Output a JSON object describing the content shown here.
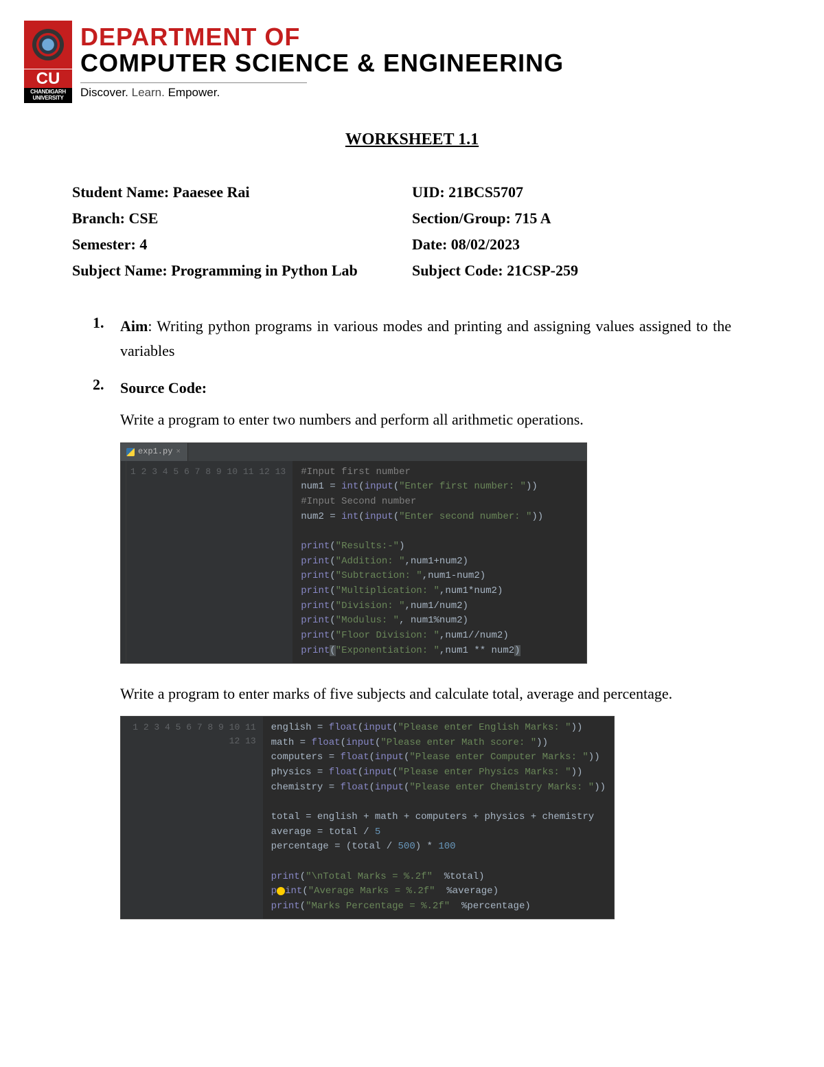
{
  "header": {
    "dept_line1": "DEPARTMENT OF",
    "dept_line2": "COMPUTER SCIENCE  & ENGINEERING",
    "cu": "CU",
    "univ": "CHANDIGARH UNIVERSITY",
    "tagline_1": "Discover. ",
    "tagline_2": "Learn. ",
    "tagline_3": "Empower."
  },
  "title": "WORKSHEET 1.1",
  "info": {
    "student_name": "Student Name: Paaesee Rai",
    "uid": "UID: 21BCS5707",
    "branch": "Branch: CSE",
    "section": "Section/Group: 715 A",
    "semester": "Semester: 4",
    "date": "Date: 08/02/2023",
    "subject_name": "Subject Name: Programming in Python Lab",
    "subject_code": "Subject Code: 21CSP-259"
  },
  "items": {
    "n1": "1.",
    "n2": "2.",
    "aim_label": "Aim",
    "aim_text": ": Writing python programs in various modes and printing and assigning values assigned to the variables",
    "src_label": "Source Code:",
    "task1": "Write a program to enter two numbers and perform all arithmetic operations.",
    "task2": "Write a program to enter marks of five subjects and calculate total, average and percentage."
  },
  "code1": {
    "tab": "exp1.py",
    "lines": [
      {
        "n": "1",
        "t": "comment",
        "c": "#Input first number"
      },
      {
        "n": "2",
        "t": "assign",
        "v": "num1",
        "fn": "int",
        "fn2": "input",
        "s": "\"Enter first number: \""
      },
      {
        "n": "3",
        "t": "comment",
        "c": "#Input Second number"
      },
      {
        "n": "4",
        "t": "assign",
        "v": "num2",
        "fn": "int",
        "fn2": "input",
        "s": "\"Enter second number: \""
      },
      {
        "n": "5",
        "t": "blank"
      },
      {
        "n": "6",
        "t": "print1",
        "s": "\"Results:-\""
      },
      {
        "n": "7",
        "t": "print2",
        "s": "\"Addition: \"",
        "e": "num1+num2"
      },
      {
        "n": "8",
        "t": "print2",
        "s": "\"Subtraction: \"",
        "e": "num1-num2"
      },
      {
        "n": "9",
        "t": "print2",
        "s": "\"Multiplication: \"",
        "e": "num1*num2"
      },
      {
        "n": "10",
        "t": "print2",
        "s": "\"Division: \"",
        "e": "num1/num2"
      },
      {
        "n": "11",
        "t": "print2sp",
        "s": "\"Modulus: \"",
        "e": "num1%num2"
      },
      {
        "n": "12",
        "t": "print2",
        "s": "\"Floor Division: \"",
        "e": "num1//num2"
      },
      {
        "n": "13",
        "t": "print2h",
        "s": "\"Exponentiation: \"",
        "e": "num1 ** num2"
      }
    ]
  },
  "code2": {
    "lines": [
      {
        "n": "1",
        "t": "fassign",
        "v": "english",
        "s": "\"Please enter English Marks: \""
      },
      {
        "n": "2",
        "t": "fassign",
        "v": "math",
        "s": "\"Please enter Math score: \""
      },
      {
        "n": "3",
        "t": "fassign",
        "v": "computers",
        "s": "\"Please enter Computer Marks: \""
      },
      {
        "n": "4",
        "t": "fassign",
        "v": "physics",
        "s": "\"Please enter Physics Marks: \""
      },
      {
        "n": "5",
        "t": "fassign",
        "v": "chemistry",
        "s": "\"Please enter Chemistry Marks: \""
      },
      {
        "n": "6",
        "t": "blank"
      },
      {
        "n": "7",
        "t": "expr",
        "v": "total",
        "e": "english + math + computers + physics + chemistry"
      },
      {
        "n": "8",
        "t": "exprn",
        "v": "average",
        "e1": "total / ",
        "num": "5"
      },
      {
        "n": "9",
        "t": "exprn2",
        "v": "percentage",
        "e1": "(total / ",
        "num": "500",
        "e2": ") * ",
        "num2": "100"
      },
      {
        "n": "10",
        "t": "blank"
      },
      {
        "n": "11",
        "t": "printf",
        "s": "\"\\nTotal Marks = %.2f\"",
        "e": "%total"
      },
      {
        "n": "12",
        "t": "printf_bulb",
        "pre": "p",
        "post": "int",
        "s": "\"Average Marks = %.2f\"",
        "e": "%average"
      },
      {
        "n": "13",
        "t": "printf",
        "s": "\"Marks Percentage = %.2f\"",
        "e": "%percentage"
      }
    ]
  }
}
